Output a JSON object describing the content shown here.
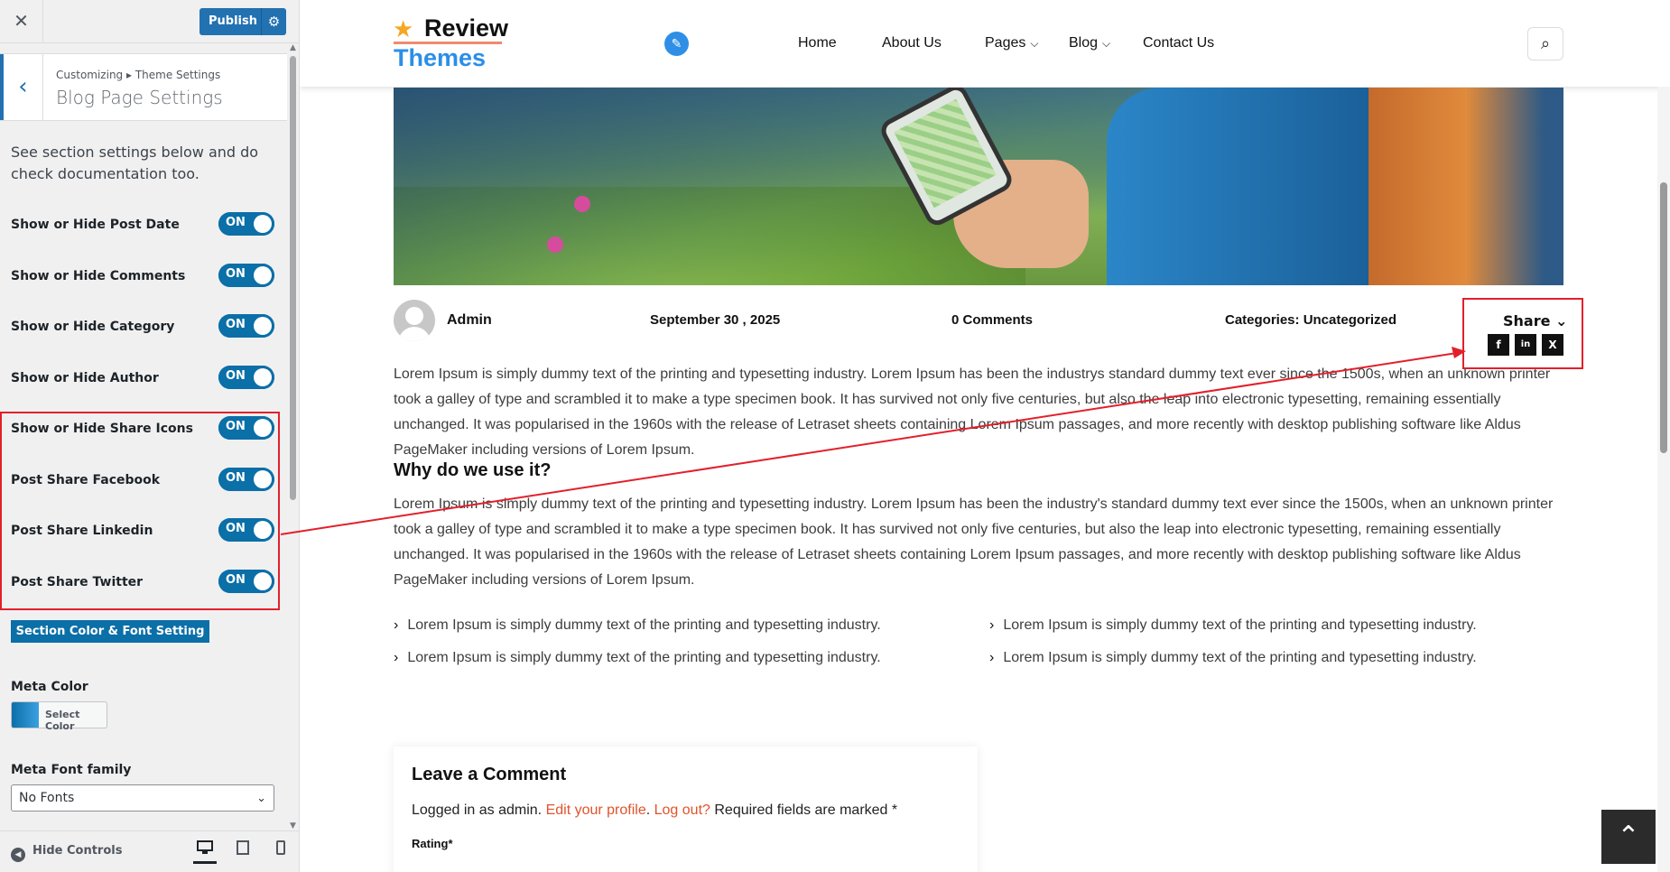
{
  "sidebar": {
    "close_icon": "close-icon",
    "publish_label": "Publish",
    "crumb": "Customizing ▸ Theme Settings",
    "title": "Blog Page Settings",
    "description": "See section settings below and do check documentation too.",
    "toggles": [
      {
        "label": "Show or Hide Post Date",
        "state": "ON"
      },
      {
        "label": "Show or Hide Comments",
        "state": "ON"
      },
      {
        "label": "Show or Hide Category",
        "state": "ON"
      },
      {
        "label": "Show or Hide Author",
        "state": "ON"
      },
      {
        "label": "Show or Hide Share Icons",
        "state": "ON"
      },
      {
        "label": "Post Share Facebook",
        "state": "ON"
      },
      {
        "label": "Post Share Linkedin",
        "state": "ON"
      },
      {
        "label": "Post Share Twitter",
        "state": "ON"
      }
    ],
    "section_button": "Section Color & Font Setting",
    "meta_color_label": "Meta Color",
    "select_color": "Select Color",
    "meta_font_label": "Meta Font family",
    "meta_font_value": "No Fonts",
    "hide_controls": "Hide Controls",
    "highlight_color": "#e2202b",
    "accent": "#0b6fa8"
  },
  "preview": {
    "logo_line1": "Review",
    "logo_line2": "Themes",
    "nav": [
      "Home",
      "About Us",
      "Pages",
      "Blog",
      "Contact Us"
    ],
    "meta": {
      "author": "Admin",
      "date": "September 30 , 2025",
      "comments": "0 Comments",
      "categories": "Categories: Uncategorized"
    },
    "share": {
      "label": "Share",
      "icons": [
        "f",
        "in",
        "X"
      ]
    },
    "para1": "Lorem Ipsum is simply dummy text of the printing and typesetting industry. Lorem Ipsum has been the industrys standard dummy text ever since the 1500s, when an unknown printer took a galley of type and scrambled it to make a type specimen book. It has survived not only five centuries, but also the leap into electronic typesetting, remaining essentially unchanged. It was popularised in the 1960s with the release of Letraset sheets containing Lorem Ipsum passages, and more recently with desktop publishing software like Aldus PageMaker including versions of Lorem Ipsum.",
    "heading2": "Why do we use it?",
    "para2": "Lorem Ipsum is simply dummy text of the printing and typesetting industry. Lorem Ipsum has been the industry's standard dummy text ever since the 1500s, when an unknown printer took a galley of type and scrambled it to make a type specimen book. It has survived not only five centuries, but also the leap into electronic typesetting, remaining essentially unchanged. It was popularised in the 1960s with the release of Letraset sheets containing Lorem Ipsum passages, and more recently with desktop publishing software like Aldus PageMaker including versions of Lorem Ipsum.",
    "list": [
      "Lorem Ipsum is simply dummy text of the printing and typesetting industry.",
      "Lorem Ipsum is simply dummy text of the printing and typesetting industry.",
      "Lorem Ipsum is simply dummy text of the printing and typesetting industry.",
      "Lorem Ipsum is simply dummy text of the printing and typesetting industry."
    ],
    "comment": {
      "title": "Leave a Comment",
      "logged_prefix": "Logged in as admin.",
      "edit_profile": "Edit your profile",
      "logout": "Log out?",
      "required": "Required fields are marked *",
      "rating": "Rating*"
    }
  }
}
